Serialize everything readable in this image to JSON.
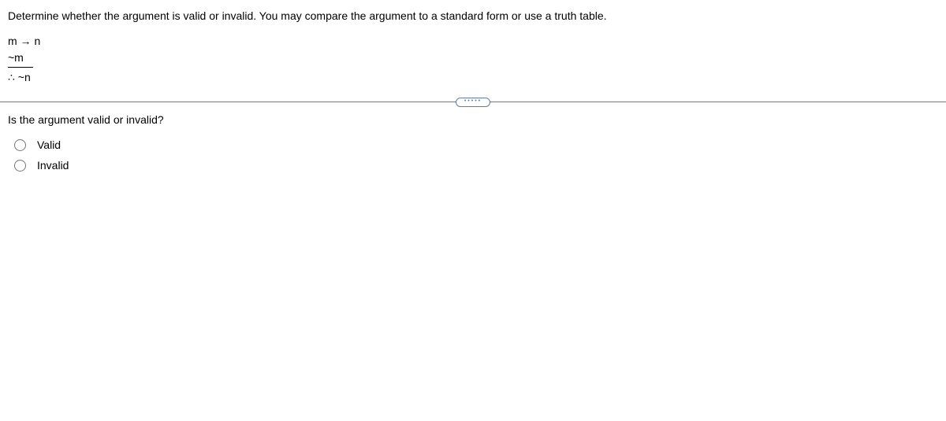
{
  "instruction": "Determine whether the argument is valid or invalid. You may compare the argument to a standard form or use a truth table.",
  "argument": {
    "premise1": "m → n",
    "premise2": "~m",
    "conclusion": "∴ ~n"
  },
  "prompt": "Is the argument valid or invalid?",
  "options": {
    "valid": "Valid",
    "invalid": "Invalid"
  }
}
